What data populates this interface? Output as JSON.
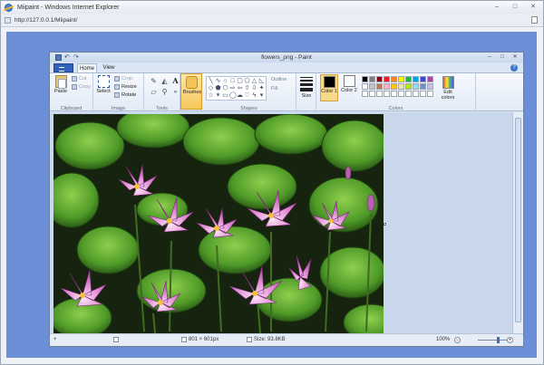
{
  "browser": {
    "title": "Miipaint - Windows Internet Explorer",
    "url": "http://127.0.0.1/Miipaint/",
    "controls": {
      "minimize": "–",
      "maximize": "□",
      "close": "✕"
    }
  },
  "paint": {
    "title": "flowers_png - Paint",
    "tabs": {
      "home": "Home",
      "view": "View"
    },
    "help": "?",
    "clipboard": {
      "paste": "Paste",
      "cut": "Cut",
      "copy": "Copy",
      "label": "Clipboard"
    },
    "image": {
      "select": "Select",
      "crop": "Crop",
      "resize": "Resize",
      "rotate": "Rotate",
      "label": "Image"
    },
    "tools": {
      "label": "Tools",
      "text_icon": "A"
    },
    "brushes": {
      "label": "Brushes"
    },
    "shapes": {
      "label": "Shapes",
      "outline": "Outline",
      "fill": "Fill"
    },
    "size": {
      "label": "Size"
    },
    "colors": {
      "color1": "Color 1",
      "color2": "Color 2",
      "edit": "Edit colors",
      "label": "Colors",
      "color1_value": "#000000",
      "color2_value": "#ffffff",
      "palette": [
        "#000000",
        "#7f7f7f",
        "#880015",
        "#ed1c24",
        "#ff7f27",
        "#fff200",
        "#22b14c",
        "#00a2e8",
        "#3f48cc",
        "#a349a4",
        "#ffffff",
        "#c3c3c3",
        "#b97a57",
        "#ffaec9",
        "#ffc90e",
        "#efe4b0",
        "#b5e61d",
        "#99d9ea",
        "#7092be",
        "#c8bfe7",
        "#ffffff",
        "#ffffff",
        "#ffffff",
        "#ffffff",
        "#ffffff",
        "#ffffff",
        "#ffffff",
        "#ffffff",
        "#ffffff",
        "#ffffff"
      ]
    },
    "status": {
      "add_icon": "+",
      "dimensions": "801 × 601px",
      "size": "Size: 93.8KB",
      "zoom": "100%",
      "zoom_minus": "−",
      "zoom_plus": "+"
    }
  }
}
